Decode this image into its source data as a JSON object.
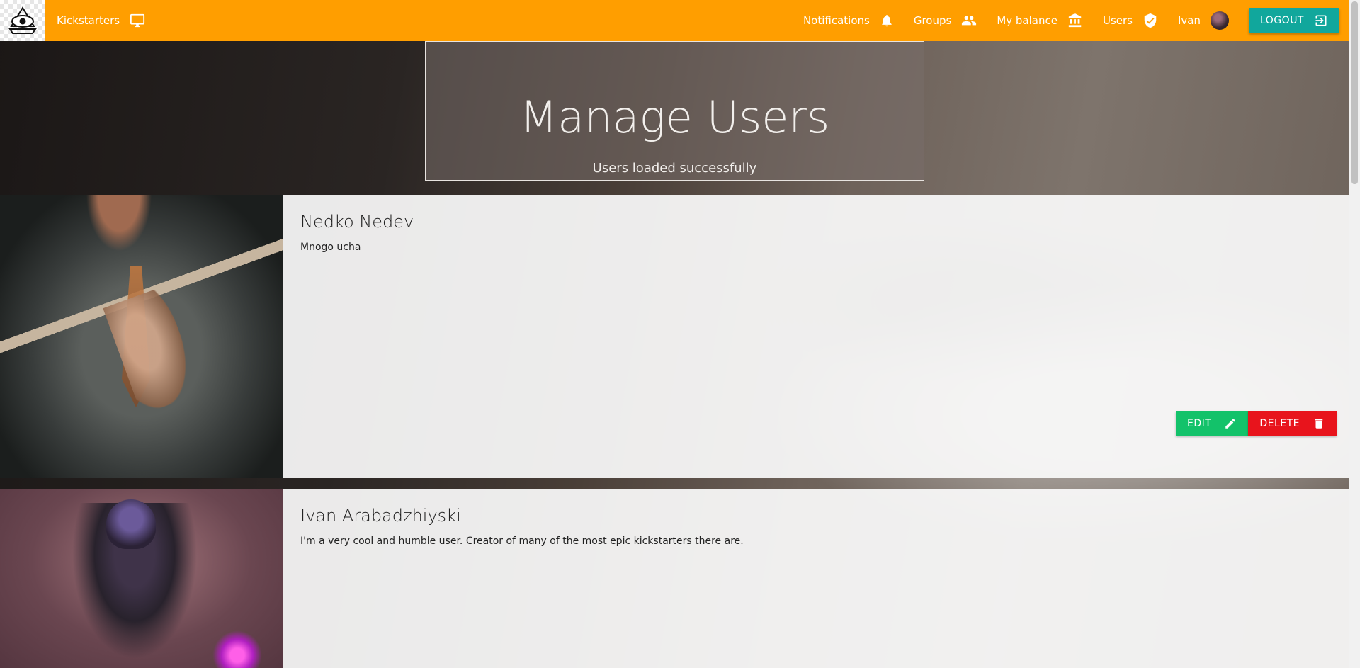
{
  "nav": {
    "brand": "Kickstarters",
    "items": [
      {
        "label": "Notifications",
        "icon": "bell-icon"
      },
      {
        "label": "Groups",
        "icon": "groups-icon"
      },
      {
        "label": "My balance",
        "icon": "bank-icon"
      },
      {
        "label": "Users",
        "icon": "shield-check-icon"
      }
    ],
    "user_name": "Ivan",
    "logout_label": "LOGOUT"
  },
  "hero": {
    "title": "Manage Users",
    "subtitle": "Users loaded successfully"
  },
  "users": [
    {
      "name": "Nedko Nedev",
      "description": "Mnogo ucha",
      "edit_label": "EDIT",
      "delete_label": "DELETE"
    },
    {
      "name": "Ivan Arabadzhiyski",
      "description": "I'm a very cool and humble user. Creator of many of the most epic kickstarters there are."
    }
  ],
  "colors": {
    "topbar": "#ff9e00",
    "logout": "#11a79c",
    "edit": "#13c26a",
    "delete": "#e8141c"
  }
}
